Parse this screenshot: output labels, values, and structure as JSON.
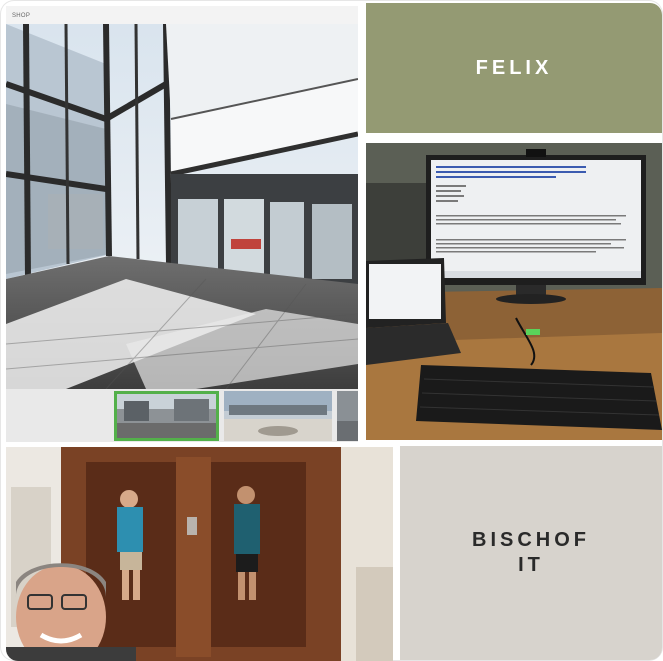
{
  "street_tile": {
    "label": "SHOP",
    "thumbnails": [
      {
        "name": "lobby-view",
        "selected": true
      },
      {
        "name": "square-view",
        "selected": false
      },
      {
        "name": "side-view",
        "selected": false
      }
    ]
  },
  "name_tiles": {
    "first_name": "FELIX",
    "last_name_lines": [
      "BISCHOF",
      "IT"
    ]
  },
  "colors": {
    "felix_tile": "#949a73",
    "bischof_tile": "#d7d3cd",
    "selected_thumb_outline": "#53b04a"
  }
}
